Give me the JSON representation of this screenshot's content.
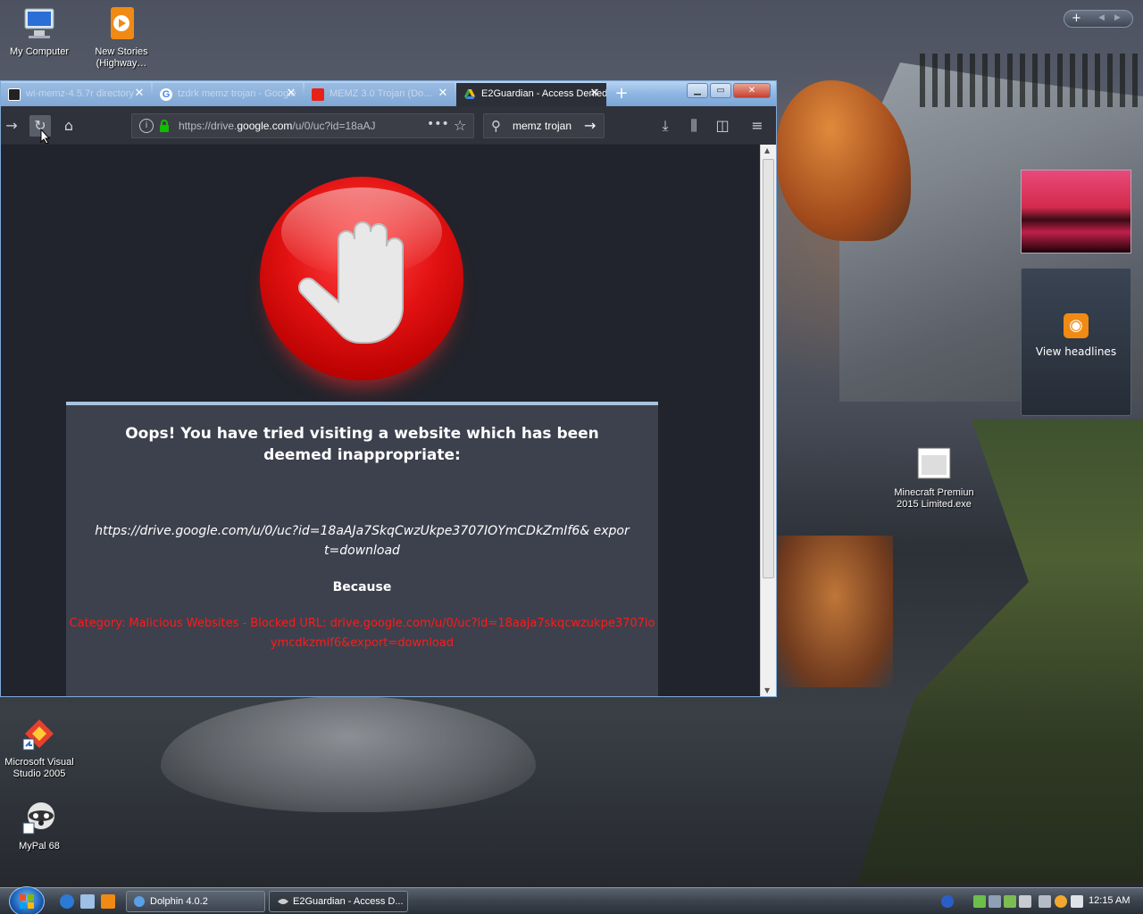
{
  "desktop": {
    "icons": [
      {
        "label": "My Computer"
      },
      {
        "label": "New Stories (Highway…"
      },
      {
        "label": "Minecraft Premiun 2015 Limited.exe"
      },
      {
        "label": "Microsoft Visual Studio 2005"
      },
      {
        "label": "MyPal 68"
      }
    ]
  },
  "browser": {
    "tabs": [
      {
        "label": "wi-memz-4.5.7r directory",
        "icon": "archive-icon"
      },
      {
        "label": "tzdrk memz trojan - Google",
        "icon": "google-icon"
      },
      {
        "label": "MEMZ 3.0 Trojan (Do…",
        "icon": "youtube-icon"
      },
      {
        "label": "E2Guardian - Access Denied",
        "icon": "drive-icon",
        "active": true
      }
    ],
    "new_tab": "+",
    "url": {
      "prefix": "https://drive.",
      "domain": "google.com",
      "rest": "/u/0/uc?id=18aAJ"
    },
    "search_query": "memz trojan",
    "page": {
      "heading": "Oops! You have tried visiting a website which has been deemed inappropriate:",
      "blocked_url": "https://drive.google.com/u/0/uc?id=18aAJa7SkqCwzUkpe3707IOYmCDkZmIf6& export=download",
      "because": "Because",
      "reason": "Category: Malicious Websites - Blocked URL: drive.google.com/u/0/uc?id=18aaja7skqcwzukpe3707ioymcdkzmif6&export=download"
    }
  },
  "gadgets": {
    "news_label": "View headlines",
    "sidebar_add": "+"
  },
  "taskbar": {
    "tasks": [
      {
        "label": "Dolphin 4.0.2"
      },
      {
        "label": "E2Guardian - Access D..."
      }
    ],
    "clock": "12:15 AM"
  },
  "colors": {
    "accent": "#7fa9d6",
    "block_red": "#ff1a1a",
    "panel_bg": "#3d414d"
  }
}
